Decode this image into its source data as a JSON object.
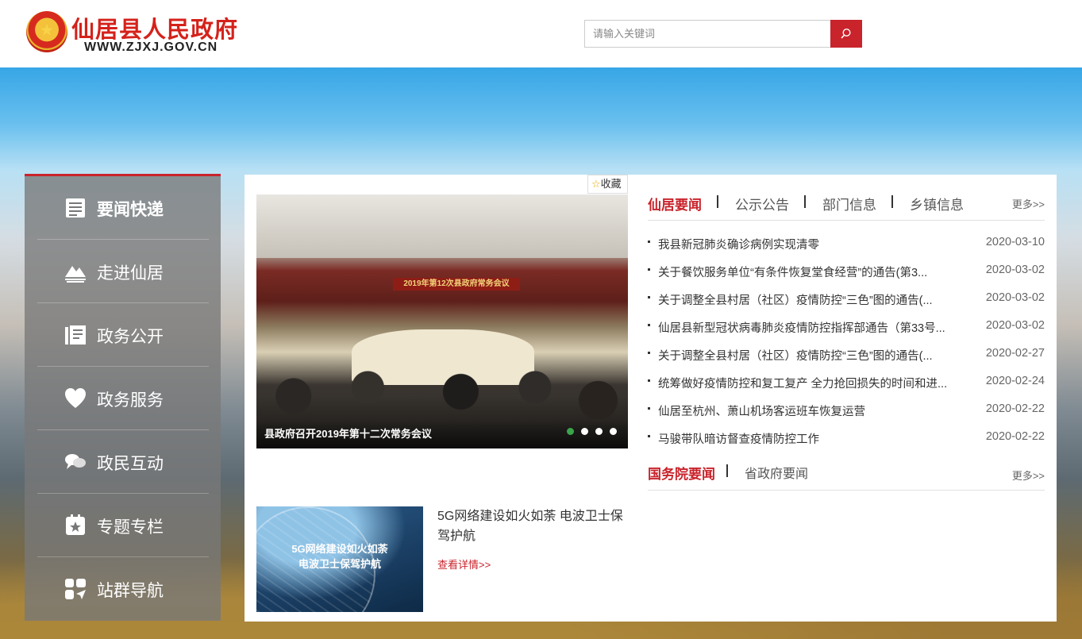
{
  "header": {
    "site_title": "仙居县人民政府",
    "site_url": "WWW.ZJXJ.GOV.CN",
    "search_placeholder": "请输入关键词",
    "search_icon": "search-icon"
  },
  "sidenav": {
    "items": [
      {
        "label": "要闻快递",
        "icon": "newspaper-icon",
        "active": true
      },
      {
        "label": "走进仙居",
        "icon": "mountain-icon"
      },
      {
        "label": "政务公开",
        "icon": "document-list-icon"
      },
      {
        "label": "政务服务",
        "icon": "heart-icon"
      },
      {
        "label": "政民互动",
        "icon": "chat-bubbles-icon"
      },
      {
        "label": "专题专栏",
        "icon": "star-badge-icon"
      },
      {
        "label": "站群导航",
        "icon": "grid-icon"
      }
    ]
  },
  "main": {
    "favorite_label": "收藏",
    "slider": {
      "caption": "县政府召开2019年第十二次常务会议",
      "meeting_banner": "2019年第12次县政府常务会议",
      "dot_count": 4,
      "active_dot": 0
    },
    "feature": {
      "image_text": [
        "5G网络建设如火如荼",
        "电波卫士保驾护航"
      ],
      "title": "5G网络建设如火如荼 电波卫士保驾护航",
      "more": "查看详情>>"
    },
    "news_tabs": [
      "仙居要闻",
      "公示公告",
      "部门信息",
      "乡镇信息"
    ],
    "news_more": "更多>>",
    "news": [
      {
        "title": "我县新冠肺炎确诊病例实现清零",
        "date": "2020-03-10"
      },
      {
        "title": "关于餐饮服务单位“有条件恢复堂食经营”的通告(第3...",
        "date": "2020-03-02"
      },
      {
        "title": "关于调整全县村居（社区）疫情防控“三色”图的通告(...",
        "date": "2020-03-02"
      },
      {
        "title": "仙居县新型冠状病毒肺炎疫情防控指挥部通告（第33号...",
        "date": "2020-03-02"
      },
      {
        "title": "关于调整全县村居（社区）疫情防控“三色”图的通告(...",
        "date": "2020-02-27"
      },
      {
        "title": "统筹做好疫情防控和复工复产 全力抢回损失的时间和进...",
        "date": "2020-02-24"
      },
      {
        "title": "仙居至杭州、萧山机场客运班车恢复运营",
        "date": "2020-02-22"
      },
      {
        "title": "马骏带队暗访督查疫情防控工作",
        "date": "2020-02-22"
      }
    ],
    "gov_tabs": [
      "国务院要闻",
      "省政府要闻"
    ],
    "gov_more": "更多>>"
  },
  "colors": {
    "accent": "#c9232b",
    "nav_bg": "#787878",
    "link_red": "#c9232b"
  }
}
